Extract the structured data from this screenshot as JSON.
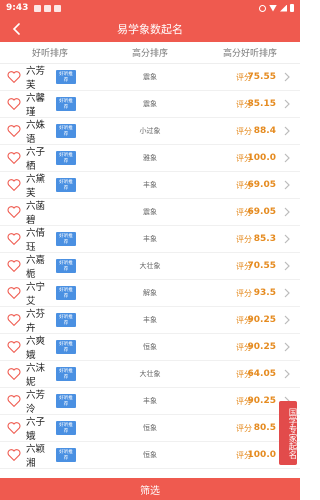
{
  "status_bar": {
    "time": "9:43"
  },
  "header": {
    "title": "易学象数起名"
  },
  "tabs": [
    {
      "label": "好听排序"
    },
    {
      "label": "高分排序"
    },
    {
      "label": "高分好听排序"
    }
  ],
  "rows": [
    {
      "name": "六芳芙",
      "badge": "好听推荐",
      "category": "震象",
      "score_label": "评分",
      "score": "75.55"
    },
    {
      "name": "六馨瑾",
      "badge": "好听推荐",
      "category": "震象",
      "score_label": "评分",
      "score": "85.15"
    },
    {
      "name": "六姝语",
      "badge": "好听推荐",
      "category": "小过象",
      "score_label": "评分",
      "score": "88.4"
    },
    {
      "name": "六子栖",
      "badge": "好听推荐",
      "category": "雅象",
      "score_label": "评分",
      "score": "100.0"
    },
    {
      "name": "六黛芙",
      "badge": "好听推荐",
      "category": "丰象",
      "score_label": "评分",
      "score": "69.05"
    },
    {
      "name": "六菡碧",
      "badge": "",
      "category": "震象",
      "score_label": "评分",
      "score": "69.05"
    },
    {
      "name": "六倩珏",
      "badge": "好听推荐",
      "category": "丰象",
      "score_label": "评分",
      "score": "85.3"
    },
    {
      "name": "六嘉栀",
      "badge": "好听推荐",
      "category": "大壮象",
      "score_label": "评分",
      "score": "70.55"
    },
    {
      "name": "六宁艾",
      "badge": "好听推荐",
      "category": "解象",
      "score_label": "评分",
      "score": "93.5"
    },
    {
      "name": "六芬卉",
      "badge": "好听推荐",
      "category": "丰象",
      "score_label": "评分",
      "score": "90.25"
    },
    {
      "name": "六爽娥",
      "badge": "好听推荐",
      "category": "恒象",
      "score_label": "评分",
      "score": "90.25"
    },
    {
      "name": "六沫妮",
      "badge": "好听推荐",
      "category": "大壮象",
      "score_label": "评分",
      "score": "64.05"
    },
    {
      "name": "六芳泠",
      "badge": "好听推荐",
      "category": "丰象",
      "score_label": "评分",
      "score": "90.25"
    },
    {
      "name": "六子娥",
      "badge": "好听推荐",
      "category": "恒象",
      "score_label": "评分",
      "score": "80.5"
    },
    {
      "name": "六颖湘",
      "badge": "好听推荐",
      "category": "恒象",
      "score_label": "评分",
      "score": "100.0"
    }
  ],
  "side_tag": {
    "text": "国学专家起名"
  },
  "bottom_bar": {
    "label": "筛选"
  },
  "colors": {
    "brand": "#ef5a4f",
    "score": "#e58b20",
    "badge": "#4a90e2",
    "side_tag": "#e24b4b"
  }
}
